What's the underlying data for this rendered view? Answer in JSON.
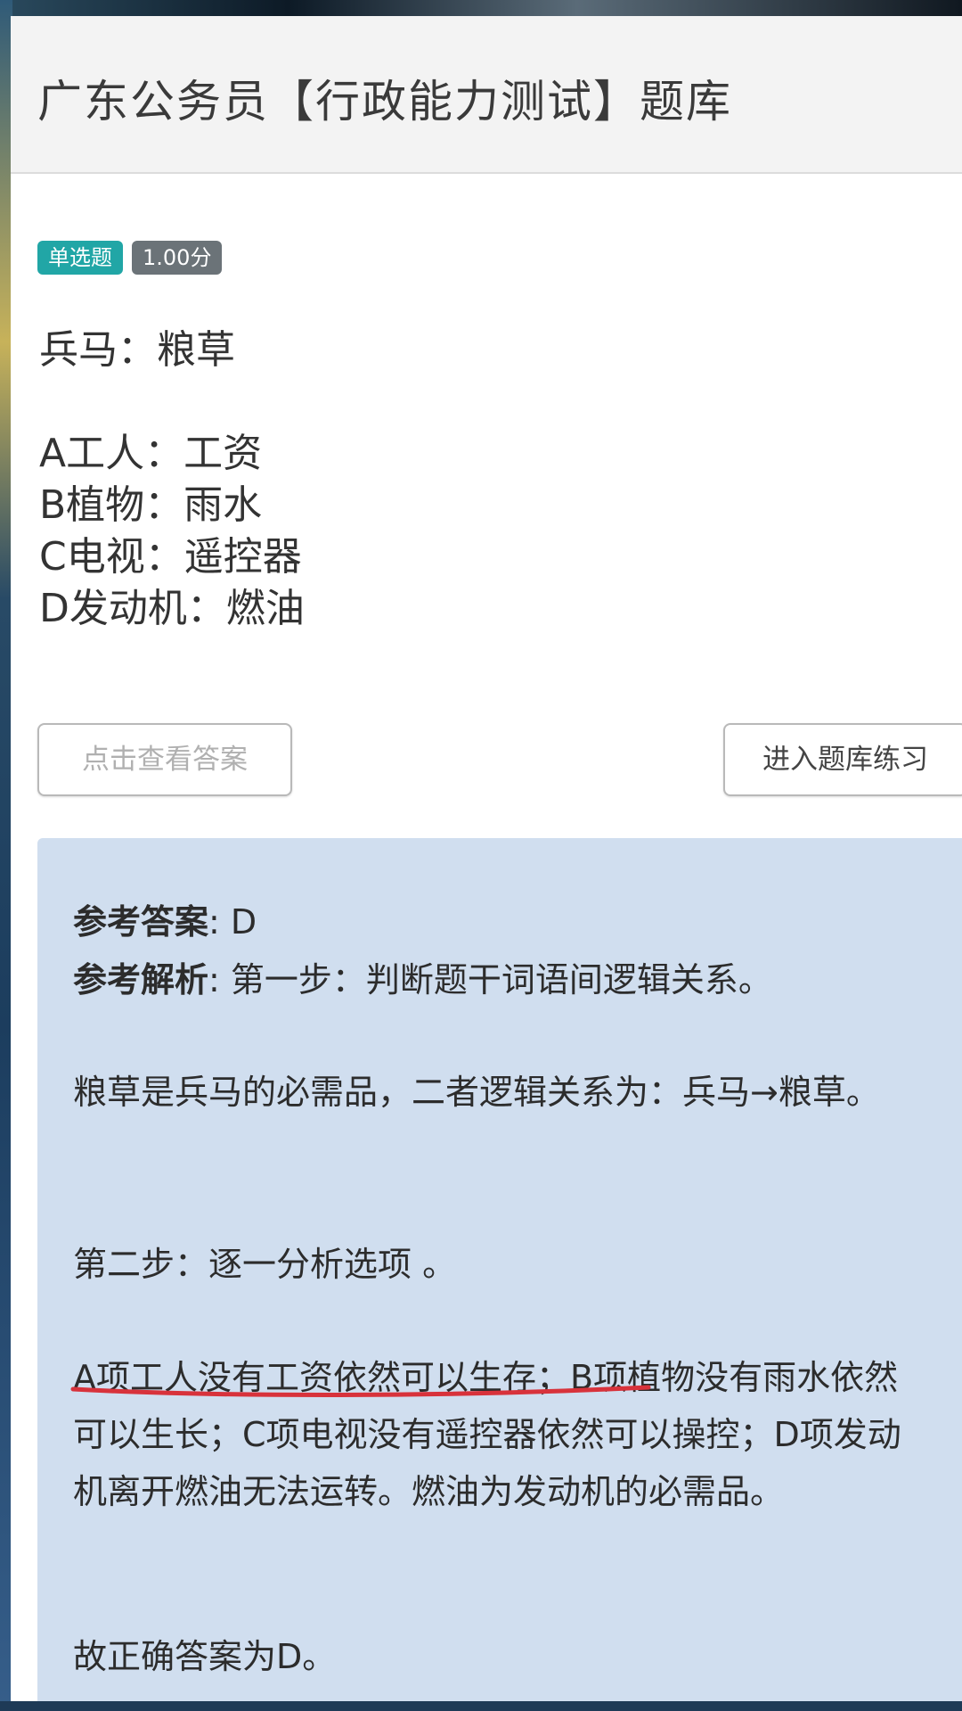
{
  "header": {
    "title": "广东公务员【行政能力测试】题库"
  },
  "badges": {
    "type": "单选题",
    "score": "1.00分"
  },
  "question": {
    "stem": "兵马：粮草"
  },
  "options": [
    "A工人：工资",
    "B植物：雨水",
    "C电视：遥控器",
    "D发动机：燃油"
  ],
  "buttons": {
    "show_answer": "点击查看答案",
    "enter_practice": "进入题库练习"
  },
  "answer": {
    "ref_label": "参考答案",
    "ref_value": ": D",
    "analysis_label": "参考解析",
    "analysis_step1": ": 第一步：判断题干词语间逻辑关系。",
    "p1": "粮草是兵马的必需品，二者逻辑关系为：兵马→粮草。",
    "p2": "第二步：逐一分析选项 。",
    "p3": "A项工人没有工资依然可以生存；B项植物没有雨水依然可以生长；C项电视没有遥控器依然可以操控；D项发动机离开燃油无法运转。燃油为发动机的必需品。",
    "p4": "故正确答案为D。"
  },
  "colors": {
    "badge_type": "#21a6a6",
    "badge_score": "#6b7378",
    "answer_box": "#d0deef",
    "underline": "#d8323b"
  }
}
